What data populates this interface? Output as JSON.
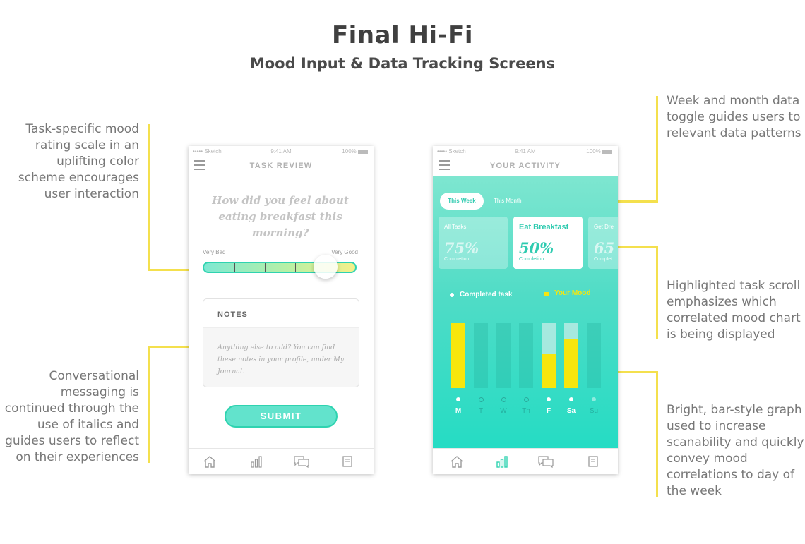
{
  "header": {
    "title": "Final Hi-Fi",
    "subtitle": "Mood Input & Data Tracking Screens"
  },
  "annotations": {
    "rating_scale": "Task-specific mood rating scale  in an uplifting color scheme encourages user interaction",
    "italics": "Conversational messaging is continued through the use of italics and guides users to reflect on their experiences",
    "toggle": "Week and month data toggle guides users to relevant data patterns",
    "task_scroll": "Highlighted task scroll emphasizes which correlated mood chart is being displayed",
    "bar_graph": "Bright, bar-style graph used to increase scanability and quickly convey mood correlations to day of the week"
  },
  "status_bar": {
    "carrier": "••••• Sketch",
    "time": "9:41 AM",
    "battery": "100%"
  },
  "task_review": {
    "nav_title": "TASK REVIEW",
    "question": "How did you feel about eating breakfast this morning?",
    "scale_low": "Very Bad",
    "scale_high": "Very Good",
    "mood_value": 0.8,
    "notes_title": "NOTES",
    "notes_placeholder": "Anything else to add? You can find these notes in your profile, under My Journal.",
    "submit_label": "SUBMIT"
  },
  "activity": {
    "nav_title": "YOUR ACTIVITY",
    "toggle_week": "This Week",
    "toggle_month": "This Month",
    "cards": [
      {
        "title": "All Tasks",
        "value": "75%",
        "sub": "Completion"
      },
      {
        "title": "Eat Breakfast",
        "value": "50%",
        "sub": "Completion"
      },
      {
        "title": "Get Dre",
        "value": "65",
        "sub": "Complet"
      }
    ],
    "legend_completed": "Completed task",
    "legend_mood": "Your Mood",
    "colors": {
      "mood": "#f7e60d",
      "accent": "#2fd3b0"
    }
  },
  "chart_data": {
    "type": "bar",
    "categories": [
      "M",
      "T",
      "W",
      "Th",
      "F",
      "Sa",
      "Su"
    ],
    "series": [
      {
        "name": "Completed task",
        "values": [
          1,
          0,
          0,
          0,
          1,
          1,
          0
        ]
      },
      {
        "name": "Your Mood",
        "values": [
          1.0,
          0,
          0,
          0,
          0.52,
          0.76,
          0
        ]
      }
    ],
    "ylim": [
      0,
      1
    ]
  },
  "tabbar": {
    "icons": [
      "home-icon",
      "chart-icon",
      "chat-icon",
      "journal-icon"
    ]
  }
}
